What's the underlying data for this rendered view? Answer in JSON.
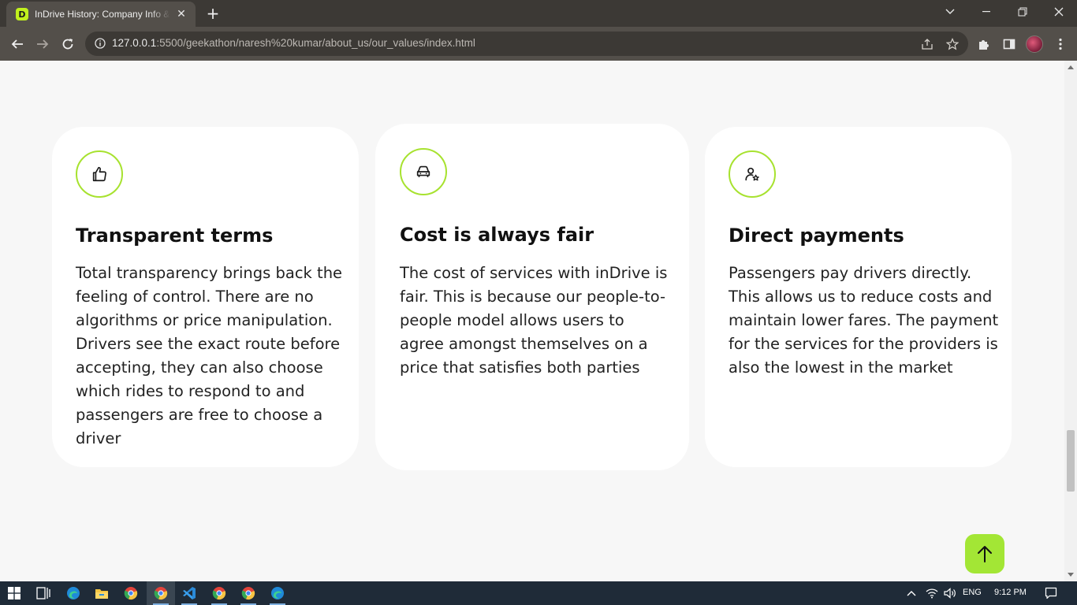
{
  "browser": {
    "tab_title": "InDrive History: Company Info &",
    "favicon_letter": "D",
    "url_host": "127.0.0.1",
    "url_rest": ":5500/geekathon/naresh%20kumar/about_us/our_values/index.html"
  },
  "cards": [
    {
      "icon": "thumbs-up-icon",
      "title": "Transparent terms",
      "lines": [
        "Total transparency brings back the",
        "feeling of control. There are no",
        "algorithms or price manipulation.",
        "Drivers see the exact route before",
        "accepting, they can also choose",
        "which rides to respond to and",
        "passengers are free to choose a",
        "driver"
      ]
    },
    {
      "icon": "car-icon",
      "title": "Cost is always fair",
      "lines": [
        "The cost of services with inDrive is",
        "fair. This is because our people-to-",
        "people model allows users to",
        "agree amongst themselves on a",
        "price that satisfies both parties"
      ]
    },
    {
      "icon": "user-star-icon",
      "title": "Direct payments",
      "lines": [
        "Passengers pay drivers directly.",
        "This allows us to reduce costs and",
        "maintain lower fares. The payment",
        "for the services for the providers is",
        "also the lowest in the market"
      ]
    }
  ],
  "taskbar": {
    "language": "ENG",
    "time": "9:12 PM"
  },
  "colors": {
    "accent": "#a7e22f",
    "scroll_top_button": "#a3e635",
    "chrome_dark": "#3c3935",
    "chrome_toolbar": "#534f4a"
  }
}
